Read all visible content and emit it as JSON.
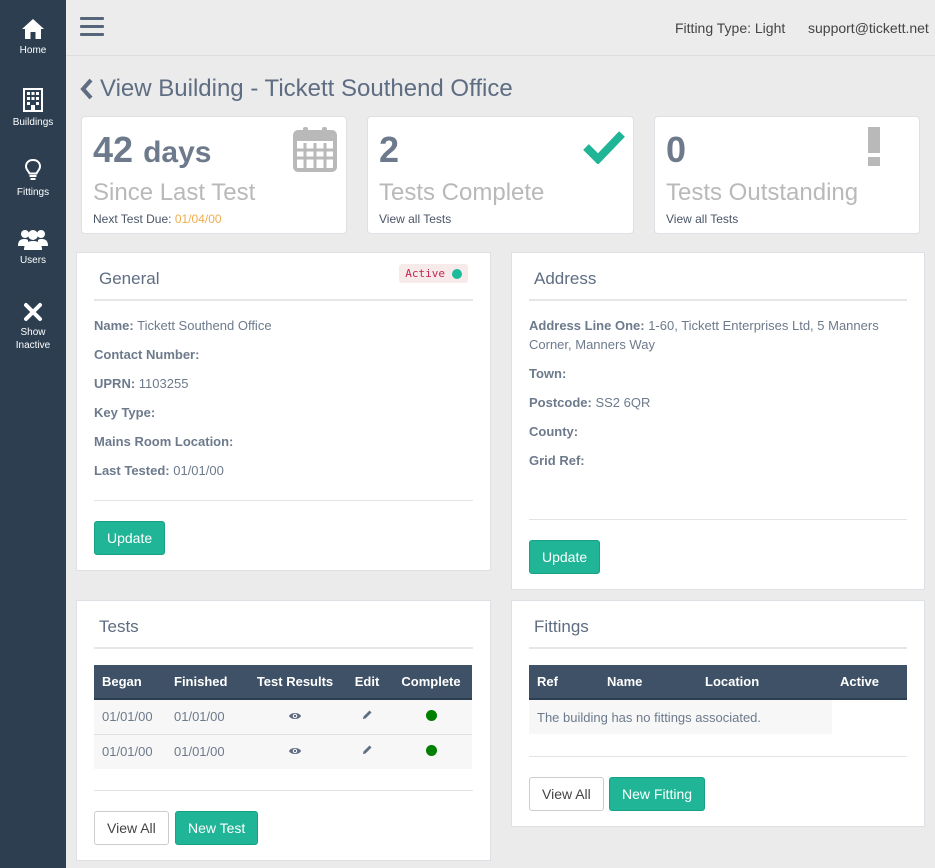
{
  "sidebar": {
    "items": [
      {
        "label": "Home",
        "icon": "home-icon"
      },
      {
        "label": "Buildings",
        "icon": "building-icon"
      },
      {
        "label": "Fittings",
        "icon": "lightbulb-icon"
      },
      {
        "label": "Users",
        "icon": "users-icon"
      },
      {
        "label": "Show Inactive",
        "icon": "close-icon"
      }
    ]
  },
  "topbar": {
    "fitting_type": "Fitting Type: Light",
    "email": "support@tickett.net"
  },
  "page": {
    "title": "View Building - Tickett Southend Office"
  },
  "stats": [
    {
      "number": "42",
      "unit": "days",
      "label": "Since Last Test",
      "sub_prefix": "Next Test Due: ",
      "sub_value": "01/04/00",
      "icon": "calendar-icon"
    },
    {
      "number": "2",
      "label": "Tests Complete",
      "link": "View all Tests",
      "icon": "check-icon"
    },
    {
      "number": "0",
      "label": "Tests Outstanding",
      "link": "View all Tests",
      "icon": "exclamation-icon"
    }
  ],
  "general": {
    "title": "General",
    "status": "Active",
    "fields": [
      {
        "label": "Name:",
        "value": "Tickett Southend Office"
      },
      {
        "label": "Contact Number:",
        "value": ""
      },
      {
        "label": "UPRN:",
        "value": "1103255"
      },
      {
        "label": "Key Type:",
        "value": ""
      },
      {
        "label": "Mains Room Location:",
        "value": ""
      },
      {
        "label": "Last Tested:",
        "value": "01/01/00"
      }
    ],
    "update_label": "Update"
  },
  "address": {
    "title": "Address",
    "fields": [
      {
        "label": "Address Line One:",
        "value": "1-60, Tickett Enterprises Ltd, 5 Manners",
        "value2": "Corner, Manners Way"
      },
      {
        "label": "Town:",
        "value": ""
      },
      {
        "label": "Postcode:",
        "value": "SS2 6QR"
      },
      {
        "label": "County:",
        "value": ""
      },
      {
        "label": "Grid Ref:",
        "value": ""
      }
    ],
    "update_label": "Update"
  },
  "tests": {
    "title": "Tests",
    "columns": [
      "Began",
      "Finished",
      "Test Results",
      "Edit",
      "Complete"
    ],
    "rows": [
      {
        "began": "01/01/00",
        "finished": "01/01/00"
      },
      {
        "began": "01/01/00",
        "finished": "01/01/00"
      }
    ],
    "view_all_label": "View All",
    "new_label": "New Test",
    "complete_color": "#008000"
  },
  "fittings": {
    "title": "Fittings",
    "columns": [
      "Ref",
      "Name",
      "Location",
      "Active"
    ],
    "empty_message": "The building has no fittings associated.",
    "view_all_label": "View All",
    "new_label": "New Fitting"
  },
  "colors": {
    "sidebar": "#2c3e50",
    "accent": "#1fb596",
    "table_header": "#3e5166",
    "due_date": "#f0ad4e"
  }
}
